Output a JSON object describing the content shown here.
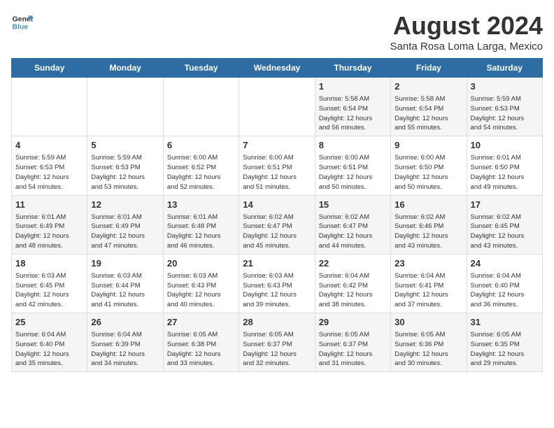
{
  "logo": {
    "line1": "General",
    "line2": "Blue"
  },
  "title": "August 2024",
  "subtitle": "Santa Rosa Loma Larga, Mexico",
  "days_of_week": [
    "Sunday",
    "Monday",
    "Tuesday",
    "Wednesday",
    "Thursday",
    "Friday",
    "Saturday"
  ],
  "weeks": [
    [
      {
        "day": "",
        "content": ""
      },
      {
        "day": "",
        "content": ""
      },
      {
        "day": "",
        "content": ""
      },
      {
        "day": "",
        "content": ""
      },
      {
        "day": "1",
        "content": "Sunrise: 5:58 AM\nSunset: 6:54 PM\nDaylight: 12 hours\nand 56 minutes."
      },
      {
        "day": "2",
        "content": "Sunrise: 5:58 AM\nSunset: 6:54 PM\nDaylight: 12 hours\nand 55 minutes."
      },
      {
        "day": "3",
        "content": "Sunrise: 5:59 AM\nSunset: 6:53 PM\nDaylight: 12 hours\nand 54 minutes."
      }
    ],
    [
      {
        "day": "4",
        "content": "Sunrise: 5:59 AM\nSunset: 6:53 PM\nDaylight: 12 hours\nand 54 minutes."
      },
      {
        "day": "5",
        "content": "Sunrise: 5:59 AM\nSunset: 6:53 PM\nDaylight: 12 hours\nand 53 minutes."
      },
      {
        "day": "6",
        "content": "Sunrise: 6:00 AM\nSunset: 6:52 PM\nDaylight: 12 hours\nand 52 minutes."
      },
      {
        "day": "7",
        "content": "Sunrise: 6:00 AM\nSunset: 6:51 PM\nDaylight: 12 hours\nand 51 minutes."
      },
      {
        "day": "8",
        "content": "Sunrise: 6:00 AM\nSunset: 6:51 PM\nDaylight: 12 hours\nand 50 minutes."
      },
      {
        "day": "9",
        "content": "Sunrise: 6:00 AM\nSunset: 6:50 PM\nDaylight: 12 hours\nand 50 minutes."
      },
      {
        "day": "10",
        "content": "Sunrise: 6:01 AM\nSunset: 6:50 PM\nDaylight: 12 hours\nand 49 minutes."
      }
    ],
    [
      {
        "day": "11",
        "content": "Sunrise: 6:01 AM\nSunset: 6:49 PM\nDaylight: 12 hours\nand 48 minutes."
      },
      {
        "day": "12",
        "content": "Sunrise: 6:01 AM\nSunset: 6:49 PM\nDaylight: 12 hours\nand 47 minutes."
      },
      {
        "day": "13",
        "content": "Sunrise: 6:01 AM\nSunset: 6:48 PM\nDaylight: 12 hours\nand 46 minutes."
      },
      {
        "day": "14",
        "content": "Sunrise: 6:02 AM\nSunset: 6:47 PM\nDaylight: 12 hours\nand 45 minutes."
      },
      {
        "day": "15",
        "content": "Sunrise: 6:02 AM\nSunset: 6:47 PM\nDaylight: 12 hours\nand 44 minutes."
      },
      {
        "day": "16",
        "content": "Sunrise: 6:02 AM\nSunset: 6:46 PM\nDaylight: 12 hours\nand 43 minutes."
      },
      {
        "day": "17",
        "content": "Sunrise: 6:02 AM\nSunset: 6:45 PM\nDaylight: 12 hours\nand 43 minutes."
      }
    ],
    [
      {
        "day": "18",
        "content": "Sunrise: 6:03 AM\nSunset: 6:45 PM\nDaylight: 12 hours\nand 42 minutes."
      },
      {
        "day": "19",
        "content": "Sunrise: 6:03 AM\nSunset: 6:44 PM\nDaylight: 12 hours\nand 41 minutes."
      },
      {
        "day": "20",
        "content": "Sunrise: 6:03 AM\nSunset: 6:43 PM\nDaylight: 12 hours\nand 40 minutes."
      },
      {
        "day": "21",
        "content": "Sunrise: 6:03 AM\nSunset: 6:43 PM\nDaylight: 12 hours\nand 39 minutes."
      },
      {
        "day": "22",
        "content": "Sunrise: 6:04 AM\nSunset: 6:42 PM\nDaylight: 12 hours\nand 38 minutes."
      },
      {
        "day": "23",
        "content": "Sunrise: 6:04 AM\nSunset: 6:41 PM\nDaylight: 12 hours\nand 37 minutes."
      },
      {
        "day": "24",
        "content": "Sunrise: 6:04 AM\nSunset: 6:40 PM\nDaylight: 12 hours\nand 36 minutes."
      }
    ],
    [
      {
        "day": "25",
        "content": "Sunrise: 6:04 AM\nSunset: 6:40 PM\nDaylight: 12 hours\nand 35 minutes."
      },
      {
        "day": "26",
        "content": "Sunrise: 6:04 AM\nSunset: 6:39 PM\nDaylight: 12 hours\nand 34 minutes."
      },
      {
        "day": "27",
        "content": "Sunrise: 6:05 AM\nSunset: 6:38 PM\nDaylight: 12 hours\nand 33 minutes."
      },
      {
        "day": "28",
        "content": "Sunrise: 6:05 AM\nSunset: 6:37 PM\nDaylight: 12 hours\nand 32 minutes."
      },
      {
        "day": "29",
        "content": "Sunrise: 6:05 AM\nSunset: 6:37 PM\nDaylight: 12 hours\nand 31 minutes."
      },
      {
        "day": "30",
        "content": "Sunrise: 6:05 AM\nSunset: 6:36 PM\nDaylight: 12 hours\nand 30 minutes."
      },
      {
        "day": "31",
        "content": "Sunrise: 6:05 AM\nSunset: 6:35 PM\nDaylight: 12 hours\nand 29 minutes."
      }
    ]
  ]
}
